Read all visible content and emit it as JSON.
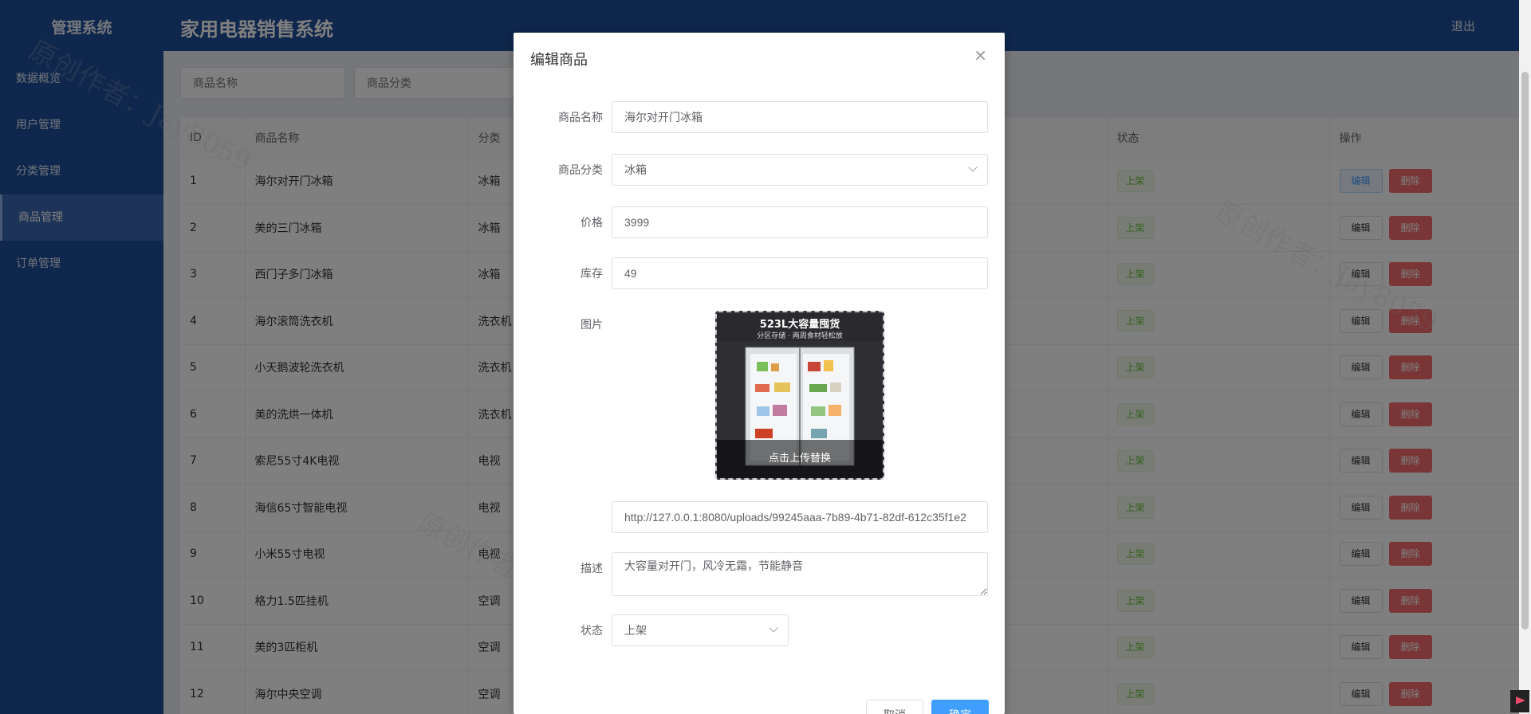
{
  "sidebar": {
    "brand": "管理系统",
    "items": [
      {
        "label": "数据概览"
      },
      {
        "label": "用户管理"
      },
      {
        "label": "分类管理"
      },
      {
        "label": "商品管理"
      },
      {
        "label": "订单管理"
      }
    ],
    "active_index": 3
  },
  "header": {
    "title": "家用电器销售系统",
    "logout_label": "退出"
  },
  "filters": {
    "name_placeholder": "商品名称",
    "category_placeholder": "商品分类"
  },
  "table": {
    "columns": {
      "id": "ID",
      "name": "商品名称",
      "category": "分类",
      "status": "状态",
      "actions": "操作"
    },
    "edit_label": "编辑",
    "delete_label": "删除",
    "rows": [
      {
        "id": "1",
        "name": "海尔对开门冰箱",
        "category": "冰箱",
        "status": "上架"
      },
      {
        "id": "2",
        "name": "美的三门冰箱",
        "category": "冰箱",
        "status": "上架"
      },
      {
        "id": "3",
        "name": "西门子多门冰箱",
        "category": "冰箱",
        "status": "上架"
      },
      {
        "id": "4",
        "name": "海尔滚筒洗衣机",
        "category": "洗衣机",
        "status": "上架"
      },
      {
        "id": "5",
        "name": "小天鹅波轮洗衣机",
        "category": "洗衣机",
        "status": "上架"
      },
      {
        "id": "6",
        "name": "美的洗烘一体机",
        "category": "洗衣机",
        "status": "上架"
      },
      {
        "id": "7",
        "name": "索尼55寸4K电视",
        "category": "电视",
        "status": "上架"
      },
      {
        "id": "8",
        "name": "海信65寸智能电视",
        "category": "电视",
        "status": "上架"
      },
      {
        "id": "9",
        "name": "小米55寸电视",
        "category": "电视",
        "status": "上架"
      },
      {
        "id": "10",
        "name": "格力1.5匹挂机",
        "category": "空调",
        "status": "上架"
      },
      {
        "id": "11",
        "name": "美的3匹柜机",
        "category": "空调",
        "status": "上架"
      },
      {
        "id": "12",
        "name": "海尔中央空调",
        "category": "空调",
        "status": "上架"
      }
    ]
  },
  "dialog": {
    "title": "编辑商品",
    "fields": {
      "name_label": "商品名称",
      "name_value": "海尔对开门冰箱",
      "category_label": "商品分类",
      "category_value": "冰箱",
      "price_label": "价格",
      "price_value": "3999",
      "stock_label": "库存",
      "stock_value": "49",
      "image_label": "图片",
      "image_url": "http://127.0.0.1:8080/uploads/99245aaa-7b89-4b71-82df-612c35f1e2",
      "image_headline": "523L大容量囤货",
      "image_subline": "分区存储 · 两周食材轻松放",
      "upload_caption": "点击上传替换",
      "desc_label": "描述",
      "desc_value": "大容量对开门，风冷无霜，节能静音",
      "status_label": "状态",
      "status_value": "上架"
    },
    "cancel_label": "取消",
    "confirm_label": "确定"
  },
  "watermark": "原创作者：Jay8059",
  "colors": {
    "sidebar_bg": "#1f4e99",
    "primary": "#409eff",
    "danger": "#f56c6c",
    "success": "#67c23a"
  }
}
